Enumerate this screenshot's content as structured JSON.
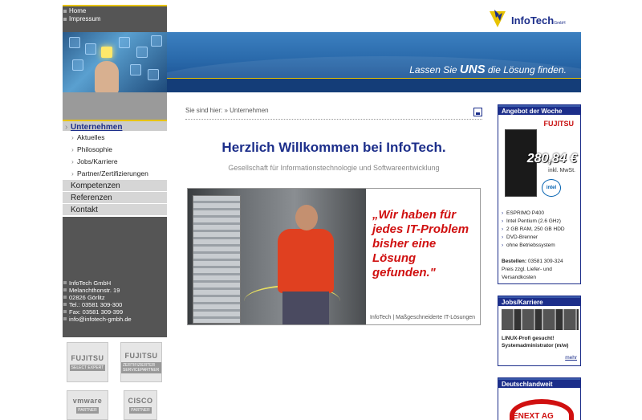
{
  "top_nav": [
    "Home",
    "Impressum"
  ],
  "brand": {
    "name": "InfoTech",
    "suffix": "GmbH",
    "accent": "#1c2e8a",
    "gold": "#e8c300"
  },
  "banner": {
    "slogan_pre": "Lassen Sie ",
    "slogan_bold": "UNS",
    "slogan_post": " die Lösung finden."
  },
  "nav": {
    "unternehmen": "Unternehmen",
    "sub": [
      "Aktuelles",
      "Philosophie",
      "Jobs/Karriere",
      "Partner/Zertifizierungen"
    ],
    "kompetenzen": "Kompetenzen",
    "referenzen": "Referenzen",
    "kontakt": "Kontakt"
  },
  "address": [
    "InfoTech GmbH",
    "Melanchthonstr. 19",
    "02826 Görlitz",
    "Tel.: 03581 309-300",
    "Fax: 03581 309-399",
    "info@infotech-gmbh.de"
  ],
  "partners": [
    {
      "logo": "FUJITSU",
      "sub": "SELECT EXPERT"
    },
    {
      "logo": "FUJITSU",
      "sub": "ZERTIFIZIERTER SERVICEPARTNER"
    },
    {
      "logo": "vmware",
      "sub": "PARTNER"
    },
    {
      "logo": "CISCO",
      "sub": "PARTNER"
    }
  ],
  "breadcrumb": "Sie sind hier: » Unternehmen",
  "headline": "Herzlich Willkommen bei InfoTech.",
  "subline": "Gesellschaft für Informationstechnologie und Softwareentwicklung",
  "teaser": {
    "quote": "„Wir haben für jedes IT-Problem bisher eine Lösung gefunden.\"",
    "caption": "InfoTech | Maßgeschneiderte IT-Lösungen"
  },
  "offer": {
    "title": "Angebot der Woche",
    "brand": "FUJITSU",
    "price": "280,84 €",
    "mwst": "inkl. MwSt.",
    "intel": "intel",
    "features": [
      "ESPRIMO P400",
      "Intel Pentium (2.6 GHz)",
      "2 GB RAM, 250 GB HDD",
      "DVD-Brenner",
      "ohne Betriebssystem"
    ],
    "order_label": "Bestellen:",
    "order_phone": "03581 309-324",
    "order_note": "Preis zzgl. Liefer- und Versandkosten"
  },
  "jobs": {
    "title": "Jobs/Karriere",
    "text1": "LINUX-Profi gesucht!",
    "text2": "Systemadministrator (m/w)",
    "more": "mehr"
  },
  "germany": {
    "title": "Deutschlandweit",
    "logo": "ENEXT AG"
  }
}
